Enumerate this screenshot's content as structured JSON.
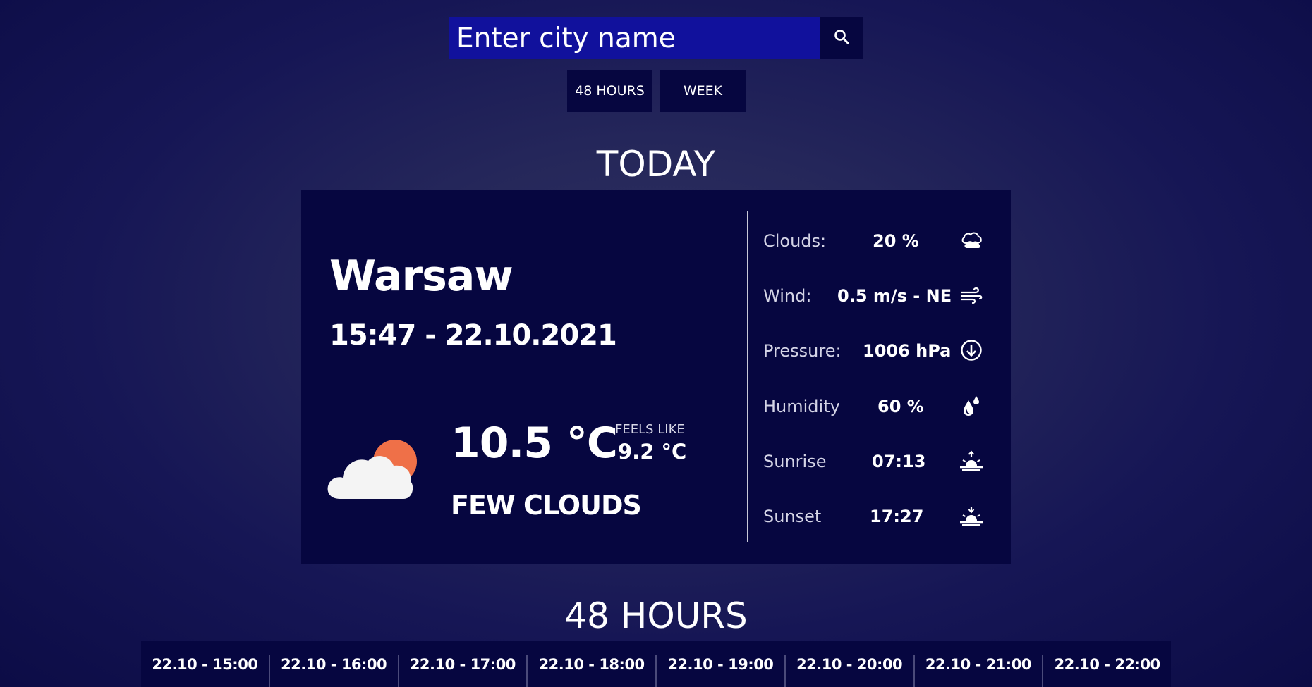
{
  "search": {
    "placeholder": "Enter city name",
    "button_icon": "search-icon"
  },
  "nav": {
    "hours_label": "48 HOURS",
    "week_label": "WEEK"
  },
  "today": {
    "title": "TODAY",
    "city": "Warsaw",
    "datetime": "15:47 - 22.10.2021",
    "temperature": "10.5 °C",
    "feels_like_label": "FEELS LIKE",
    "feels_like_value": "9.2 °C",
    "description": "FEW CLOUDS",
    "weather_icon": "few-clouds-icon",
    "stats": [
      {
        "label": "Clouds:",
        "value": "20 %",
        "icon": "cloud-icon"
      },
      {
        "label": "Wind:",
        "value": "0.5 m/s - NE",
        "icon": "wind-icon"
      },
      {
        "label": "Pressure:",
        "value": "1006 hPa",
        "icon": "pressure-icon"
      },
      {
        "label": "Humidity",
        "value": "60 %",
        "icon": "humidity-icon"
      },
      {
        "label": "Sunrise",
        "value": "07:13",
        "icon": "sunrise-icon"
      },
      {
        "label": "Sunset",
        "value": "17:27",
        "icon": "sunset-icon"
      }
    ]
  },
  "hours": {
    "title": "48 HOURS",
    "items": [
      "22.10 - 15:00",
      "22.10 - 16:00",
      "22.10 - 17:00",
      "22.10 - 18:00",
      "22.10 - 19:00",
      "22.10 - 20:00",
      "22.10 - 21:00",
      "22.10 - 22:00"
    ]
  },
  "colors": {
    "background": "#1c1d55",
    "card": "#060640",
    "search_input": "#11119c",
    "sun": "#ef7048",
    "cloud": "#f4f4f4"
  }
}
